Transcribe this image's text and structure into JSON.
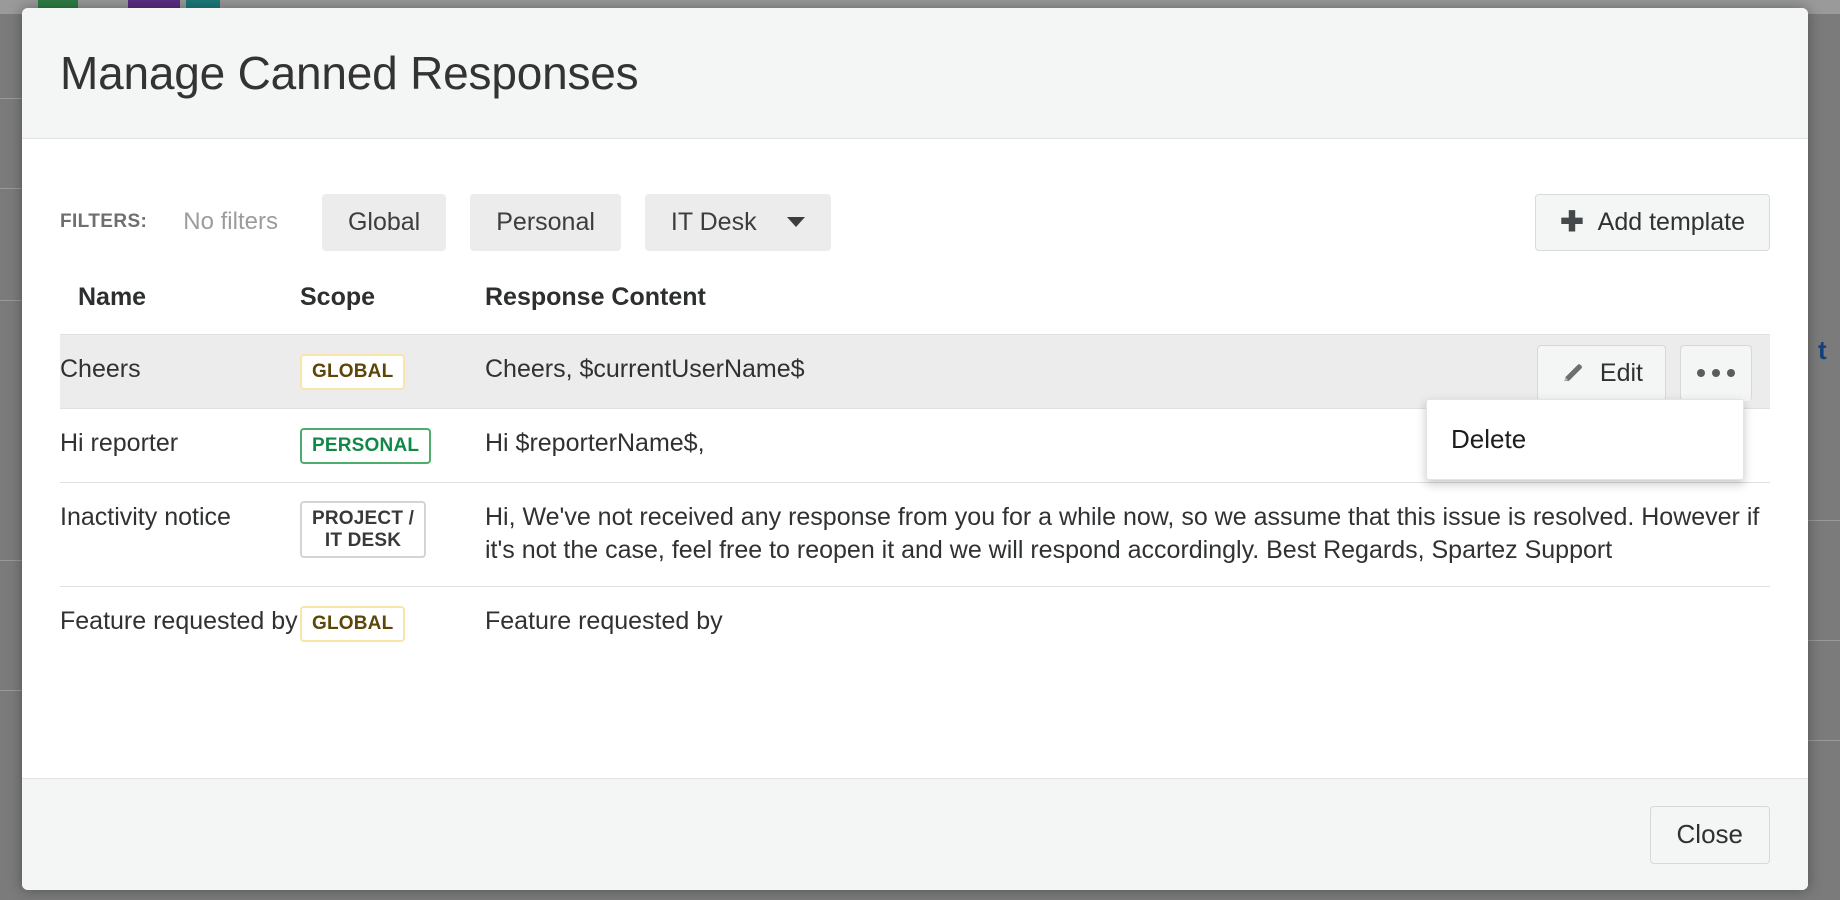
{
  "backdrop": {
    "fragment_text": "t",
    "overlay_color": "#7b7b7b"
  },
  "dialog": {
    "title": "Manage Canned Responses",
    "close_label": "Close"
  },
  "filters": {
    "label": "FILTERS:",
    "status_text": "No filters",
    "chips": [
      {
        "label": "Global",
        "has_caret": false
      },
      {
        "label": "Personal",
        "has_caret": false
      },
      {
        "label": "IT Desk",
        "has_caret": true
      }
    ],
    "add_template_label": "Add template",
    "add_icon": "plus-icon"
  },
  "table": {
    "headers": {
      "name": "Name",
      "scope": "Scope",
      "content": "Response Content"
    },
    "rows": [
      {
        "name": "Cheers",
        "scope": "GLOBAL",
        "scope_kind": "global",
        "content": "Cheers, $currentUserName$",
        "selected": true,
        "edit_label": "Edit",
        "edit_icon": "pencil-icon",
        "more_icon": "ellipsis-icon"
      },
      {
        "name": "Hi reporter",
        "scope": "PERSONAL",
        "scope_kind": "personal",
        "content": "Hi $reporterName$,",
        "selected": false
      },
      {
        "name": "Inactivity notice",
        "scope": "PROJECT /\nIT DESK",
        "scope_kind": "project",
        "content": "Hi, We've not received any response from you for a while now, so we assume that this issue is resolved. However if it's not the case, feel free to reopen it and we will respond accordingly. Best Regards, Spartez Support",
        "selected": false
      },
      {
        "name": "Feature requested by",
        "scope": "GLOBAL",
        "scope_kind": "global",
        "content": "Feature requested by",
        "selected": false
      }
    ]
  },
  "context_menu": {
    "visible": true,
    "items": [
      {
        "label": "Delete"
      }
    ]
  },
  "colors": {
    "global_text": "#5c4708",
    "global_border": "#f7e6a8",
    "personal_text": "#11884a",
    "personal_border": "#4cad6c",
    "project_text": "#37393b",
    "project_border": "#d3d4d5",
    "row_selected_bg": "#ececed",
    "header_bg": "#f4f5f5",
    "link_blue": "#17407f"
  }
}
